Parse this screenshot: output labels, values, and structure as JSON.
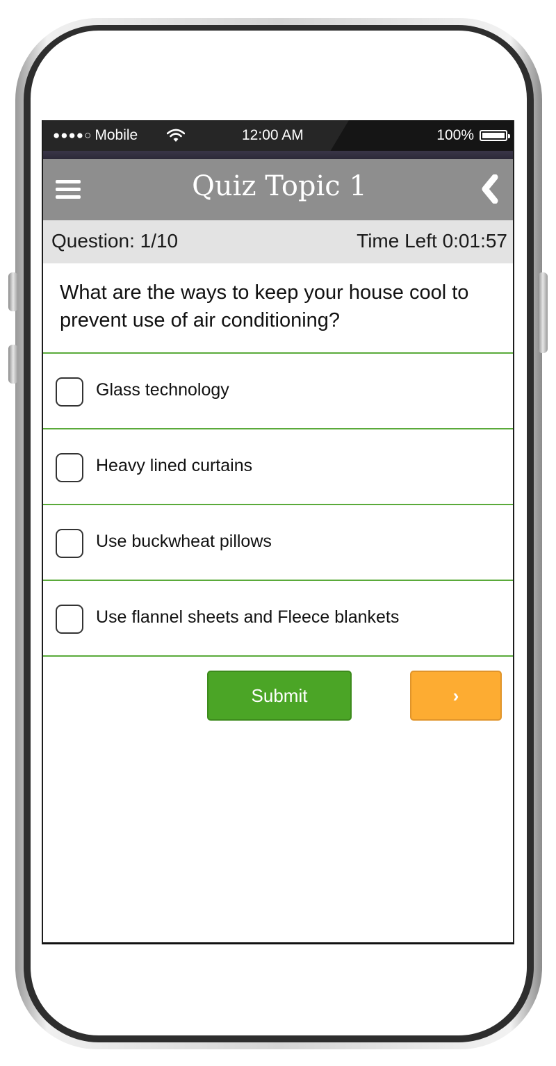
{
  "status_bar": {
    "signal_dots": "●●●●○",
    "carrier": "Mobile",
    "time": "12:00 AM",
    "battery": "100%",
    "wifi_icon": "wifi-icon"
  },
  "header": {
    "title": "Quiz Topic 1",
    "menu_icon": "hamburger-menu-icon",
    "back_icon": "chevron-left-icon"
  },
  "quiz": {
    "question_count": "Question: 1/10",
    "time_left": "Time Left 0:01:57",
    "question": "What are the ways to keep your house cool to prevent use of air conditioning?",
    "options": [
      {
        "label": "Glass technology",
        "checked": false
      },
      {
        "label": "Heavy lined curtains",
        "checked": false
      },
      {
        "label": "Use buckwheat pillows",
        "checked": false
      },
      {
        "label": "Use flannel sheets and Fleece blankets",
        "checked": false
      }
    ]
  },
  "actions": {
    "submit_label": "Submit",
    "next_label": "›"
  },
  "colors": {
    "header_bg": "#8e8e8e",
    "info_bar_bg": "#e3e3e3",
    "divider": "#5aaa3a",
    "submit_bg": "#4ba526",
    "next_bg": "#fdac32"
  }
}
